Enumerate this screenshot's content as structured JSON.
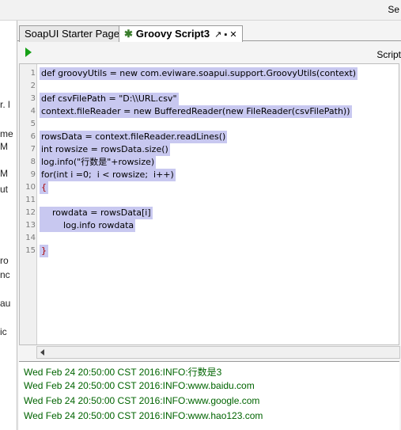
{
  "topbar": {
    "right_text": "Se"
  },
  "left_panel": {
    "fragments": [
      "r. l",
      "me",
      "M",
      "M",
      "ut",
      "ro",
      "nc",
      "au",
      "ic"
    ]
  },
  "tabs": [
    {
      "label": "SoapUI Starter Page",
      "active": false
    },
    {
      "label": "Groovy Script3",
      "active": true,
      "icon": "groovy-star-icon",
      "controls": "↗ ▪ ✕"
    }
  ],
  "toolbar": {
    "run_icon": "play-icon",
    "right_label": "Script"
  },
  "code": {
    "lines": [
      {
        "num": "1",
        "text": "def groovyUtils = new com.eviware.soapui.support.GroovyUtils(context)"
      },
      {
        "num": "2",
        "text": ""
      },
      {
        "num": "3",
        "text": "def csvFilePath = \"D:\\\\URL.csv\""
      },
      {
        "num": "4",
        "text": "context.fileReader = new BufferedReader(new FileReader(csvFilePath))"
      },
      {
        "num": "5",
        "text": ""
      },
      {
        "num": "6",
        "text": "rowsData = context.fileReader.readLines()"
      },
      {
        "num": "7",
        "text": "int rowsize = rowsData.size()"
      },
      {
        "num": "8",
        "text": "log.info(\"行数是\"+rowsize)"
      },
      {
        "num": "9",
        "text": "for(int i =0;  i < rowsize;  i++)"
      },
      {
        "num": "10",
        "text": "{"
      },
      {
        "num": "11",
        "text": ""
      },
      {
        "num": "12",
        "text": "    rowdata = rowsData[i]"
      },
      {
        "num": "13",
        "text": "        log.info rowdata"
      },
      {
        "num": "14",
        "text": ""
      },
      {
        "num": "15",
        "text": "}"
      }
    ]
  },
  "output": {
    "lines": [
      "Wed Feb 24 20:50:00 CST 2016:INFO:行数是3",
      "Wed Feb 24 20:50:00 CST 2016:INFO:www.baidu.com",
      "Wed Feb 24 20:50:00 CST 2016:INFO:www.google.com",
      "Wed Feb 24 20:50:00 CST 2016:INFO:www.hao123.com"
    ]
  },
  "colors": {
    "highlight": "#c8c8f0",
    "keyword": "#0000c0",
    "string": "#b040c0",
    "output_text": "#006400",
    "run_icon": "#16a016"
  }
}
